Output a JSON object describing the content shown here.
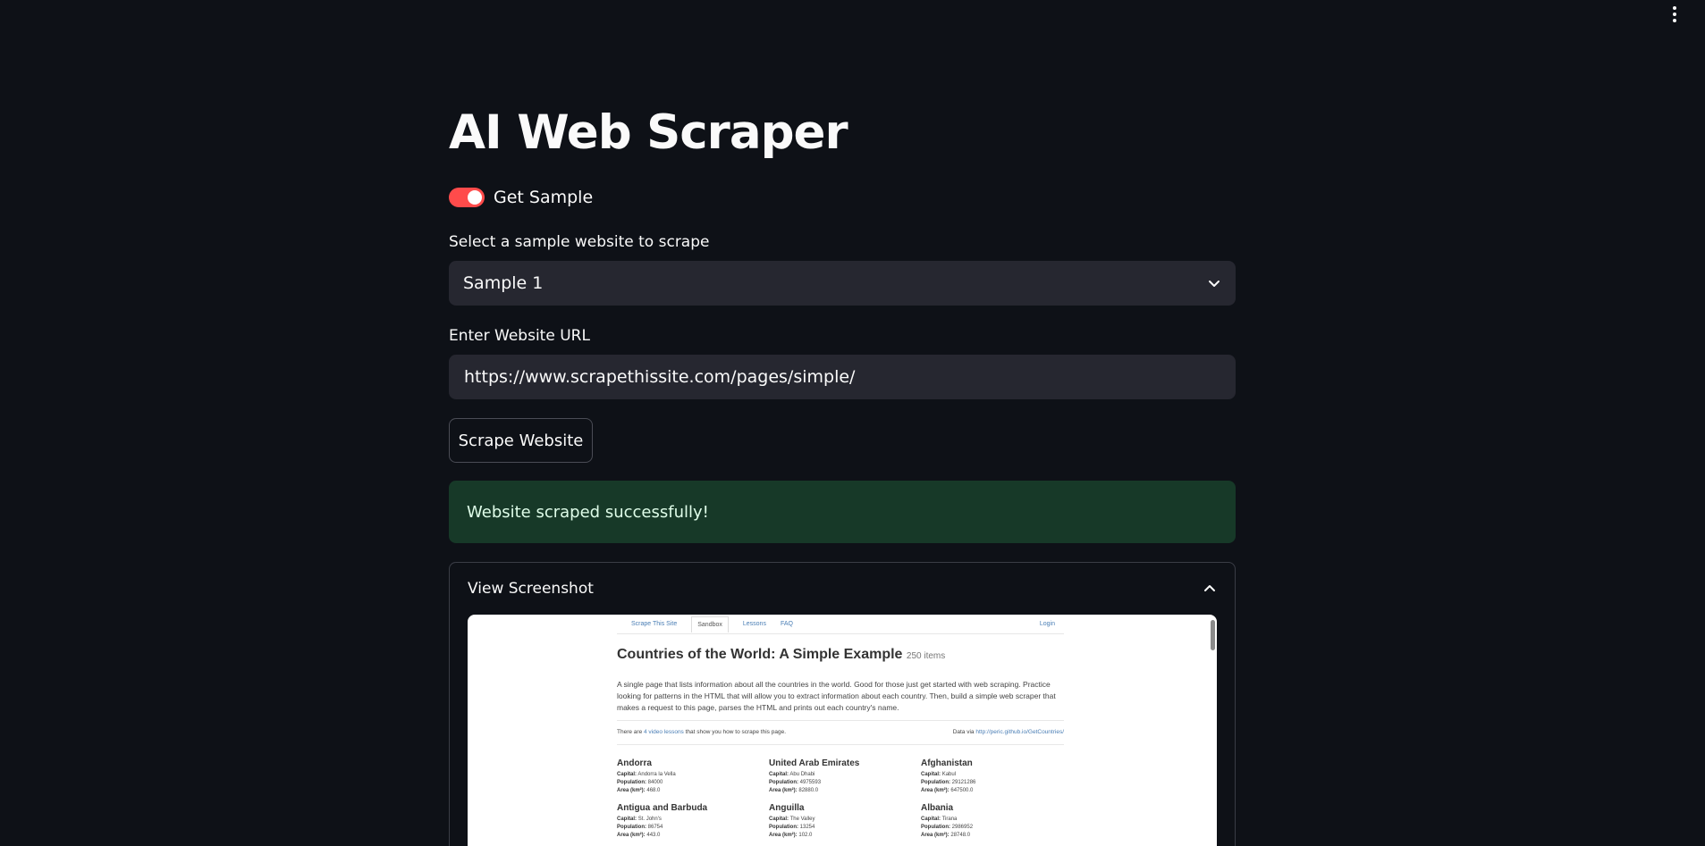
{
  "app": {
    "title": "AI Web Scraper"
  },
  "toggle": {
    "label": "Get Sample",
    "on": true,
    "color": "#ff4b4b"
  },
  "sample_select": {
    "label": "Select a sample website to scrape",
    "value": "Sample 1"
  },
  "url_input": {
    "label": "Enter Website URL",
    "value": "https://www.scrapethissite.com/pages/simple/"
  },
  "scrape_button": {
    "label": "Scrape Website"
  },
  "success_alert": {
    "text": "Website scraped successfully!"
  },
  "expander": {
    "title": "View Screenshot"
  },
  "screenshot": {
    "nav": {
      "brand": "Scrape This Site",
      "sandbox": "Sandbox",
      "lessons": "Lessons",
      "faq": "FAQ",
      "login": "Login"
    },
    "heading": "Countries of the World: A Simple Example",
    "count": "250 items",
    "description": "A single page that lists information about all the countries in the world. Good for those just get started with web scraping. Practice looking for patterns in the HTML that will allow you to extract information about each country. Then, build a simple web scraper that makes a request to this page, parses the HTML and prints out each country's name.",
    "note_prefix": "There are",
    "note_link": "4 video lessons",
    "note_suffix": "that show you how to scrape this page.",
    "data_via": "Data via",
    "data_link": "http://peric.github.io/GetCountries/",
    "labels": {
      "capital": "Capital:",
      "population": "Population:",
      "area": "Area (km²):"
    },
    "countries": [
      {
        "name": "Andorra",
        "capital": "Andorra la Vella",
        "population": "84000",
        "area": "468.0"
      },
      {
        "name": "United Arab Emirates",
        "capital": "Abu Dhabi",
        "population": "4975593",
        "area": "82880.0"
      },
      {
        "name": "Afghanistan",
        "capital": "Kabul",
        "population": "29121286",
        "area": "647500.0"
      },
      {
        "name": "Antigua and Barbuda",
        "capital": "St. John's",
        "population": "86754",
        "area": "443.0"
      },
      {
        "name": "Anguilla",
        "capital": "The Valley",
        "population": "13254",
        "area": "102.0"
      },
      {
        "name": "Albania",
        "capital": "Tirana",
        "population": "2986952",
        "area": "28748.0"
      }
    ]
  }
}
